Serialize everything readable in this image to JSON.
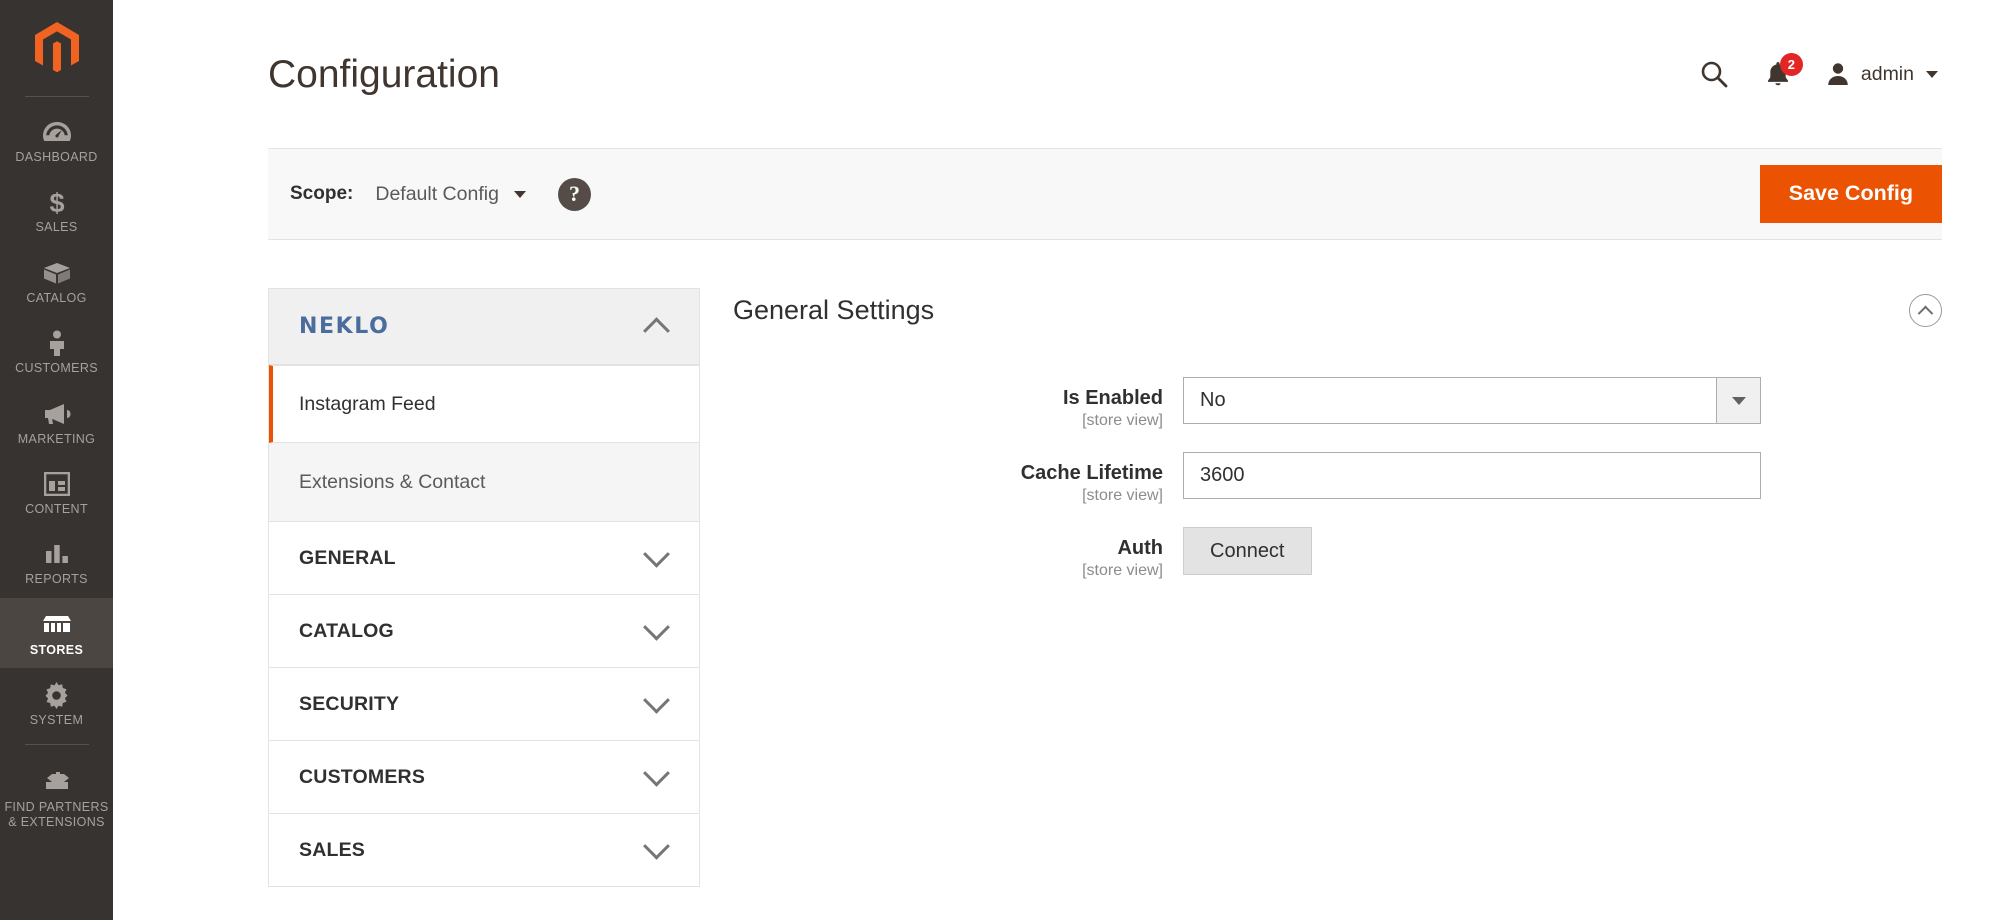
{
  "leftnav": {
    "logo": "magento-logo",
    "items": [
      {
        "label": "DASHBOARD",
        "icon": "dashboard-icon",
        "active": false
      },
      {
        "label": "SALES",
        "icon": "dollar-icon",
        "active": false
      },
      {
        "label": "CATALOG",
        "icon": "box-icon",
        "active": false
      },
      {
        "label": "CUSTOMERS",
        "icon": "person-icon",
        "active": false
      },
      {
        "label": "MARKETING",
        "icon": "megaphone-icon",
        "active": false
      },
      {
        "label": "CONTENT",
        "icon": "layout-icon",
        "active": false
      },
      {
        "label": "REPORTS",
        "icon": "bar-chart-icon",
        "active": false
      },
      {
        "label": "STORES",
        "icon": "storefront-icon",
        "active": true
      },
      {
        "label": "SYSTEM",
        "icon": "gear-icon",
        "active": false
      },
      {
        "label": "FIND PARTNERS\n& EXTENSIONS",
        "icon": "extension-icon",
        "active": false
      }
    ]
  },
  "header": {
    "title": "Configuration",
    "search_icon": "search-icon",
    "notifications_icon": "bell-icon",
    "notifications_count": "2",
    "user_icon": "user-avatar-icon",
    "user_name": "admin"
  },
  "scope_bar": {
    "label": "Scope:",
    "value": "Default Config",
    "help_icon": "question-mark-icon",
    "save_label": "Save Config"
  },
  "config_nav": {
    "group_title": "NEKLO",
    "group_collapse_icon": "chevron-up-icon",
    "sub_items": [
      {
        "label": "Instagram Feed",
        "current": true
      },
      {
        "label": "Extensions & Contact",
        "current": false
      }
    ],
    "sections": [
      {
        "label": "GENERAL",
        "icon": "chevron-down-icon"
      },
      {
        "label": "CATALOG",
        "icon": "chevron-down-icon"
      },
      {
        "label": "SECURITY",
        "icon": "chevron-down-icon"
      },
      {
        "label": "CUSTOMERS",
        "icon": "chevron-down-icon"
      },
      {
        "label": "SALES",
        "icon": "chevron-down-icon"
      }
    ]
  },
  "content": {
    "title": "General Settings",
    "collapse_icon": "circle-chevron-up-icon",
    "fields": [
      {
        "label": "Is Enabled",
        "scope": "[store view]",
        "type": "select",
        "value": "No"
      },
      {
        "label": "Cache Lifetime",
        "scope": "[store view]",
        "type": "text",
        "value": "3600"
      },
      {
        "label": "Auth",
        "scope": "[store view]",
        "type": "button",
        "value": "Connect"
      }
    ]
  },
  "colors": {
    "accent_orange": "#eb5202",
    "nav_bg": "#373330",
    "neklo_blue": "#4a6d9e",
    "badge_red": "#e22626"
  }
}
